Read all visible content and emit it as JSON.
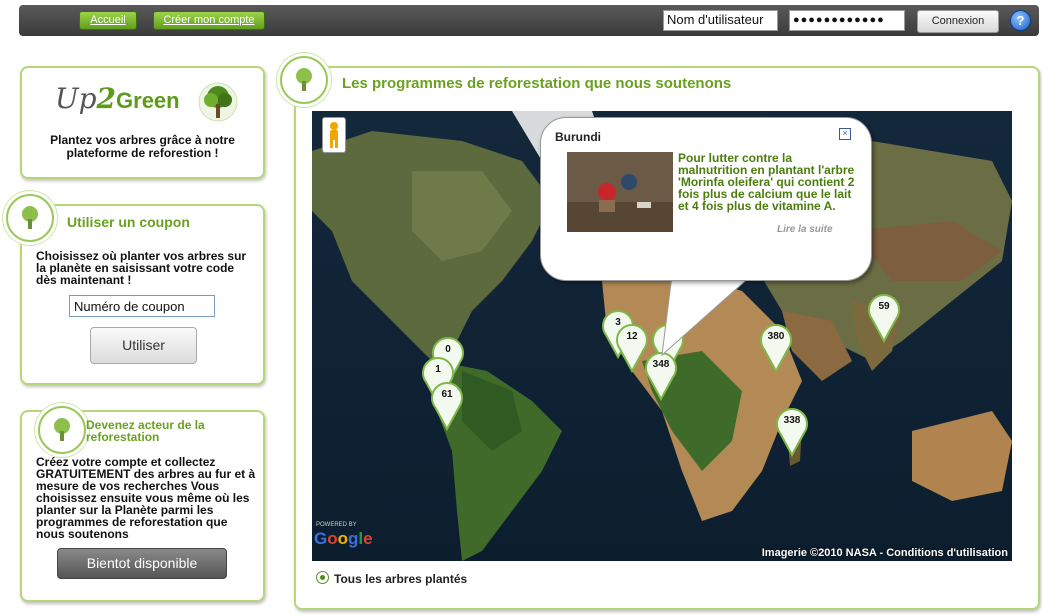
{
  "nav": {
    "home": "Accueil",
    "create_account": "Créer mon compte"
  },
  "login": {
    "username": "Nom d'utilisateur",
    "password": "●●●●●●●●●●●●",
    "connect": "Connexion",
    "help": "?"
  },
  "logo": {
    "up": "Up",
    "two": "2",
    "green": "Green",
    "tagline": "Plantez vos arbres grâce à notre plateforme de reforestion !"
  },
  "coupon": {
    "title": "Utiliser un coupon",
    "text": "Choisissez où planter vos arbres sur la planète en saisissant votre code dès maintenant !",
    "input_value": "Numéro de coupon",
    "button": "Utiliser"
  },
  "actor": {
    "title": "Devenez acteur de la reforestation",
    "text": "Créez votre compte et collectez GRATUITEMENT des arbres au fur et à mesure de vos recherches Vous choisissez ensuite vous même où les planter sur la Planète parmi les programmes de reforestation que nous soutenons",
    "button": "Bientot disponible"
  },
  "map_panel": {
    "title": "Les programmes de reforestation que nous soutenons",
    "radio_label": "Tous les arbres plantés",
    "powered_by": "POWERED BY",
    "google": "Google",
    "imagery": "Imagerie ©2010 NASA - Conditions d'utilisation"
  },
  "popup": {
    "title": "Burundi",
    "close": "×",
    "text": "Pour lutter contre la malnutrition en plantant l'arbre 'Morinfa oleifera' qui contient 2 fois plus de calcium que le lait et 4 fois plus de vitamine A.",
    "more": "Lire la suite"
  },
  "markers": [
    "0",
    "1",
    "61",
    "3",
    "12",
    "0",
    "348",
    "380",
    "59",
    "338"
  ]
}
